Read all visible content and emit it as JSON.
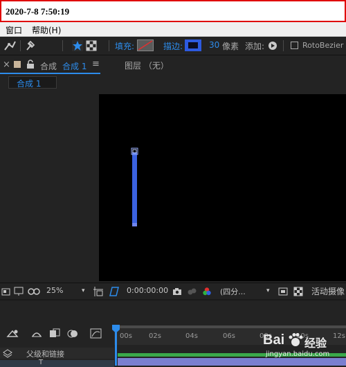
{
  "timestamp": "2020-7-8 7:50:19",
  "menu": {
    "window": "窗口",
    "help": "帮助(H)"
  },
  "toolbar": {
    "fill_label": "填充:",
    "stroke_label": "描边:",
    "stroke_width": "30",
    "stroke_unit": "像素",
    "add_label": "添加:",
    "roto_label": "RotoBezier"
  },
  "panel": {
    "close": "×",
    "comp_prefix": "合成",
    "comp_name": "合成 1",
    "layer_tab": "图层 （无）",
    "subtab": "合成 1"
  },
  "viewer": {
    "zoom": "25%",
    "timecode": "0:00:00:00",
    "resolution": "(四分...",
    "camera": "活动摄像"
  },
  "timeline": {
    "parent_label": "父级和链接",
    "ticks": [
      "00s",
      "02s",
      "04s",
      "06s",
      "08s",
      "10s",
      "12s"
    ],
    "layer_letter": "T"
  },
  "watermark": {
    "brand": "Bai",
    "cn": "经验",
    "site": "jingyan.baidu.com"
  },
  "colors": {
    "accent": "#2d8ceb",
    "shape_blue": "#3b62e0",
    "border_red": "#e00000"
  }
}
